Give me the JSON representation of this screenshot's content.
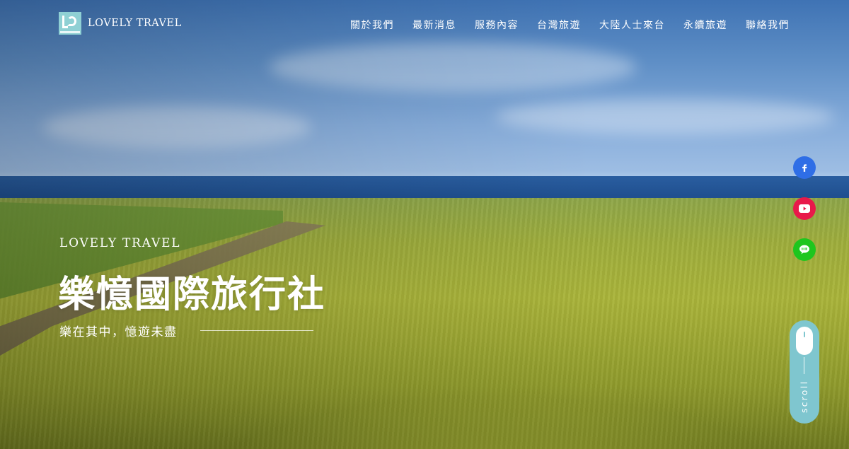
{
  "header": {
    "logo_text": "LOVELY TRAVEL",
    "nav": [
      {
        "label": "關於我們"
      },
      {
        "label": "最新消息"
      },
      {
        "label": "服務內容"
      },
      {
        "label": "台灣旅遊"
      },
      {
        "label": "大陸人士來台"
      },
      {
        "label": "永續旅遊"
      },
      {
        "label": "聯絡我們"
      }
    ]
  },
  "hero": {
    "eyebrow": "LOVELY TRAVEL",
    "title": "樂憶國際旅行社",
    "tagline": "樂在其中，憶遊未盡"
  },
  "social": {
    "facebook_icon": "facebook-icon",
    "youtube_icon": "youtube-icon",
    "line_icon": "line-icon"
  },
  "scroll": {
    "label": "scroll"
  },
  "colors": {
    "facebook": "#2f6ee6",
    "youtube": "#e8194a",
    "line": "#1ec61e",
    "scroll_bg": "#7fc6cf",
    "logo_bg": "#8fd0d4"
  }
}
